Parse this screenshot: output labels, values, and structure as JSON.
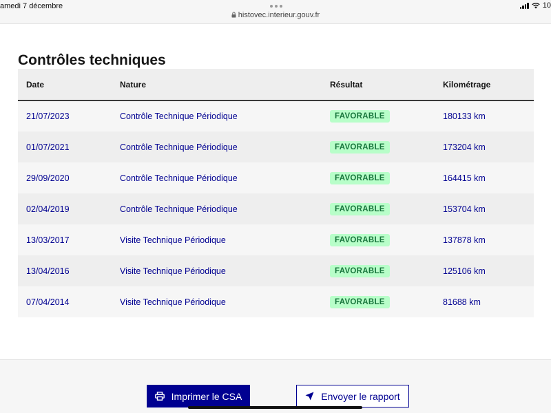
{
  "status_bar": {
    "date": "amedi 7 décembre",
    "battery": "10"
  },
  "browser": {
    "url": "histovec.interieur.gouv.fr"
  },
  "page": {
    "title": "Contrôles techniques"
  },
  "table": {
    "headers": {
      "date": "Date",
      "nature": "Nature",
      "result": "Résultat",
      "mileage": "Kilométrage"
    },
    "rows": [
      {
        "date": "21/07/2023",
        "nature": "Contrôle Technique Périodique",
        "result": "FAVORABLE",
        "mileage": "180133 km"
      },
      {
        "date": "01/07/2021",
        "nature": "Contrôle Technique Périodique",
        "result": "FAVORABLE",
        "mileage": "173204 km"
      },
      {
        "date": "29/09/2020",
        "nature": "Contrôle Technique Périodique",
        "result": "FAVORABLE",
        "mileage": "164415 km"
      },
      {
        "date": "02/04/2019",
        "nature": "Contrôle Technique Périodique",
        "result": "FAVORABLE",
        "mileage": "153704 km"
      },
      {
        "date": "13/03/2017",
        "nature": "Visite Technique Périodique",
        "result": "FAVORABLE",
        "mileage": "137878 km"
      },
      {
        "date": "13/04/2016",
        "nature": "Visite Technique Périodique",
        "result": "FAVORABLE",
        "mileage": "125106 km"
      },
      {
        "date": "07/04/2014",
        "nature": "Visite Technique Périodique",
        "result": "FAVORABLE",
        "mileage": "81688 km"
      }
    ]
  },
  "actions": {
    "print_label": "Imprimer le CSA",
    "send_label": "Envoyer le rapport"
  },
  "icons": {
    "print": "printer-icon",
    "send": "send-icon",
    "lock": "lock-icon",
    "wifi": "wifi-icon",
    "signal": "signal-icon"
  },
  "colors": {
    "primary": "#000091",
    "badge_bg": "#b8fec9",
    "badge_text": "#18753c"
  }
}
